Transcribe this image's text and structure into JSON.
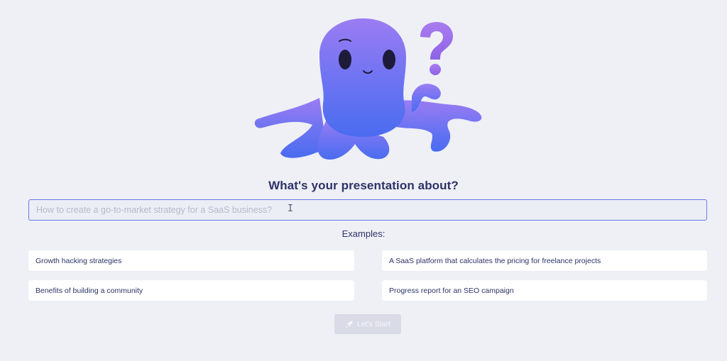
{
  "mascot": {
    "icon": "confused-octopus-icon",
    "accent_top": "#9b7cf3",
    "accent_bottom": "#4a6cf0"
  },
  "main": {
    "title": "What's your presentation about?",
    "input": {
      "value": "",
      "placeholder": "How to create a go-to-market strategy for a SaaS business?"
    },
    "examples_label": "Examples:",
    "examples": [
      "Growth hacking strategies",
      "A SaaS platform that calculates the pricing for freelance projects",
      "Benefits of building a community",
      "Progress report for an SEO campaign"
    ],
    "start_button": {
      "label": "Let's Start",
      "icon": "rocket-icon",
      "disabled": true
    }
  }
}
